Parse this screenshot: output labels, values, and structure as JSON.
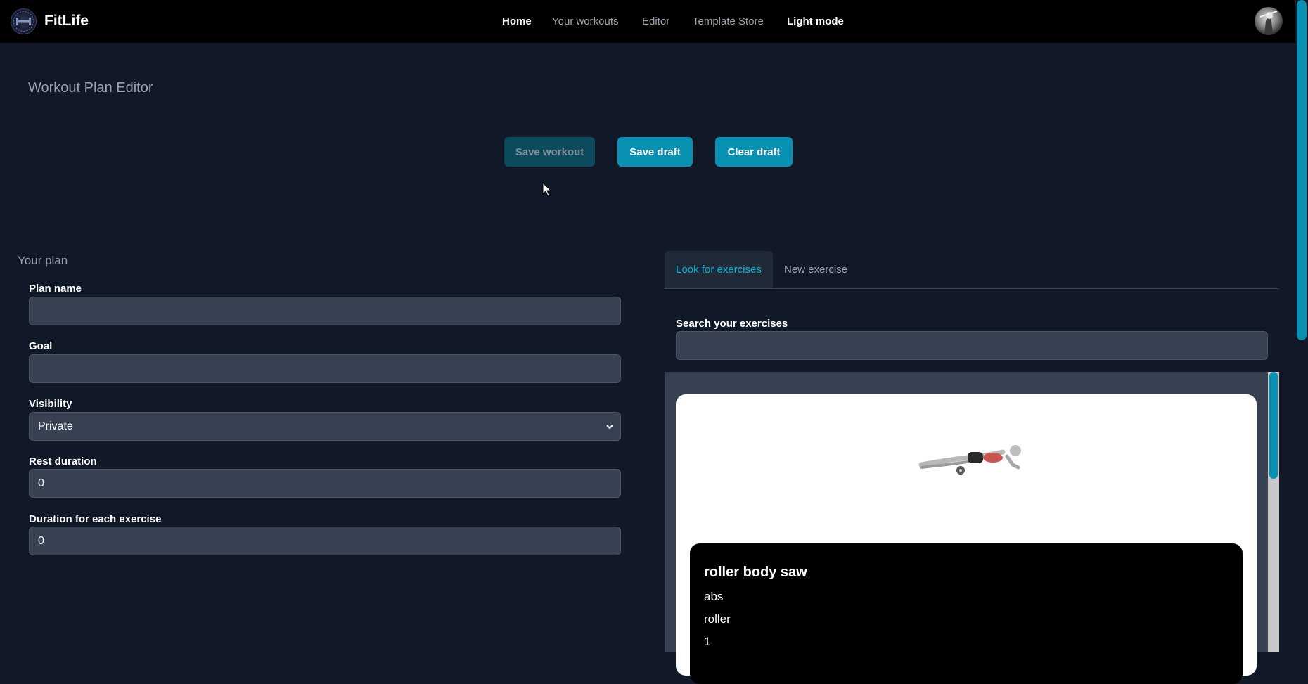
{
  "nav": {
    "brand": "FitLife",
    "links": [
      "Home",
      "Your workouts",
      "Editor",
      "Template Store",
      "Light mode"
    ]
  },
  "page": {
    "title": "Workout Plan Editor"
  },
  "actions": {
    "save_workout": "Save workout",
    "save_draft": "Save draft",
    "clear_draft": "Clear draft"
  },
  "plan": {
    "section_title": "Your plan",
    "plan_name_label": "Plan name",
    "plan_name_value": "",
    "goal_label": "Goal",
    "goal_value": "",
    "visibility_label": "Visibility",
    "visibility_value": "Private",
    "rest_label": "Rest duration",
    "rest_value": "0",
    "duration_label": "Duration for each exercise",
    "duration_value": "0"
  },
  "exercises": {
    "tabs": [
      "Look for exercises",
      "New exercise"
    ],
    "search_label": "Search your exercises",
    "search_value": "",
    "results": [
      {
        "name": "roller body saw",
        "target": "abs",
        "equipment": "roller",
        "count": "1"
      }
    ]
  },
  "colors": {
    "accent": "#0891b2",
    "accent_text": "#06b6d4",
    "background": "#111827",
    "input_bg": "#374151"
  }
}
